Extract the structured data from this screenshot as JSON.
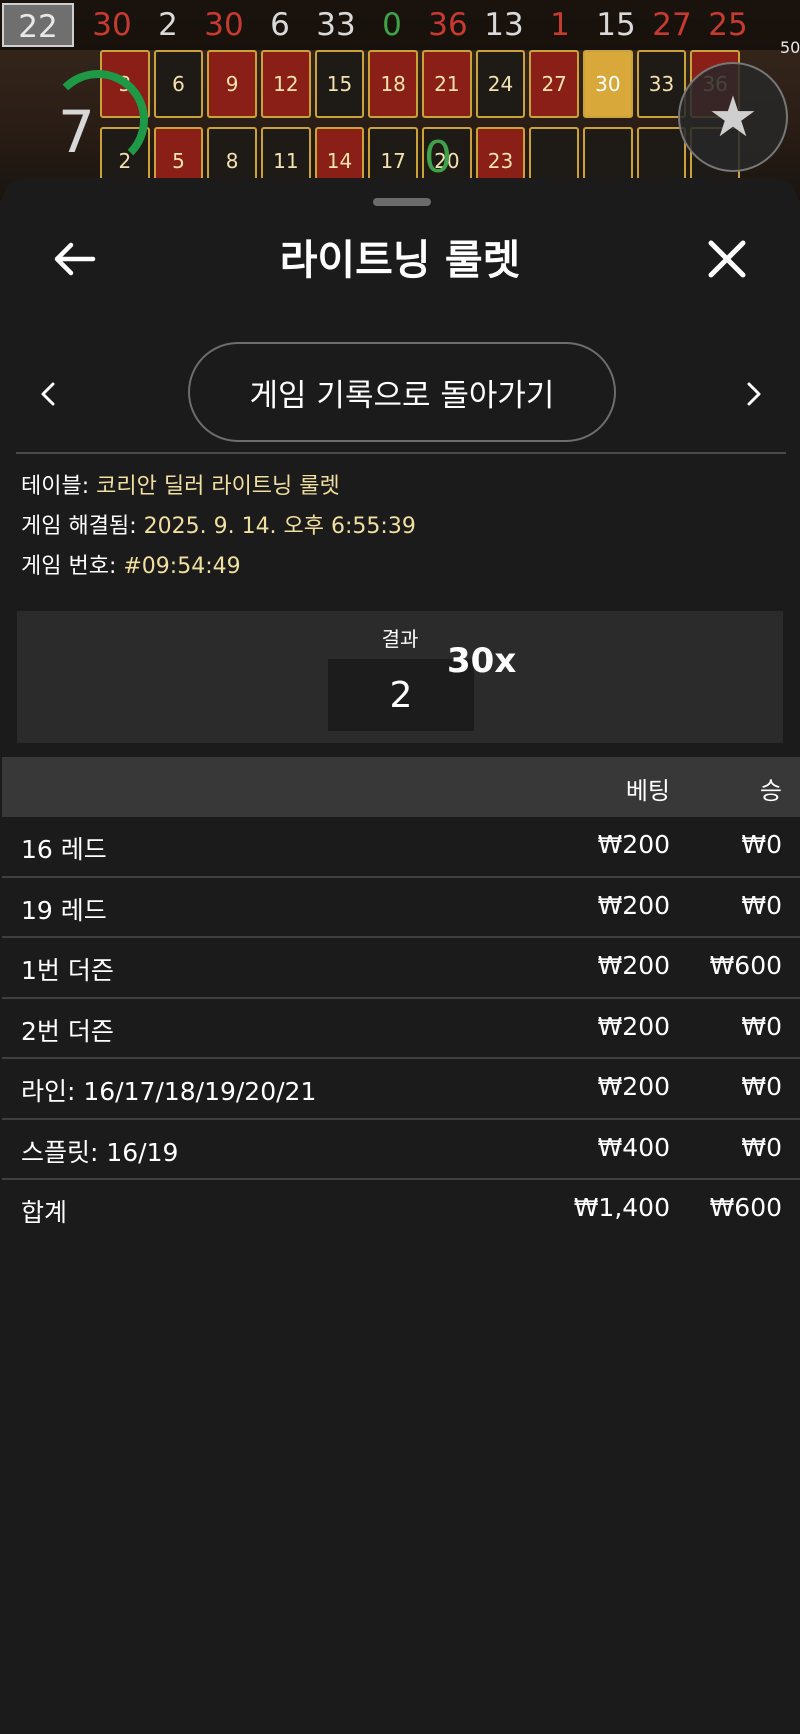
{
  "background": {
    "history": [
      {
        "n": "22",
        "color": "latest"
      },
      {
        "n": "30",
        "color": "red"
      },
      {
        "n": "2",
        "color": "black"
      },
      {
        "n": "30",
        "color": "red"
      },
      {
        "n": "6",
        "color": "black"
      },
      {
        "n": "33",
        "color": "black"
      },
      {
        "n": "0",
        "color": "green"
      },
      {
        "n": "36",
        "color": "red"
      },
      {
        "n": "13",
        "color": "black"
      },
      {
        "n": "1",
        "color": "red"
      },
      {
        "n": "15",
        "color": "black"
      },
      {
        "n": "27",
        "color": "red"
      },
      {
        "n": "25",
        "color": "red"
      }
    ],
    "board_row1": [
      "3",
      "6",
      "9",
      "12",
      "15",
      "18",
      "21",
      "24",
      "27",
      "30",
      "33",
      "36"
    ],
    "board_row2": [
      "2",
      "5",
      "8",
      "11",
      "14",
      "17",
      "20",
      "23",
      "",
      "",
      "",
      ""
    ],
    "timer": "7",
    "zero": "0",
    "corner_mini": "50"
  },
  "sheet": {
    "title": "라이트닝 룰렛",
    "back_to_history": "게임 기록으로 돌아가기",
    "info": {
      "table_label": "테이블: ",
      "table_value": "코리안 딜러 라이트닝 룰렛",
      "resolved_label": "게임 해결됨: ",
      "resolved_value": "2025. 9. 14. 오후 6:55:39",
      "number_label": "게임 번호: ",
      "number_value": "#09:54:49"
    },
    "result": {
      "label": "결과",
      "number": "2",
      "multiplier": "30x"
    },
    "table": {
      "col_bet": "베팅",
      "col_win": "승",
      "rows": [
        {
          "name": "16 레드",
          "bet": "₩200",
          "win": "₩0"
        },
        {
          "name": "19 레드",
          "bet": "₩200",
          "win": "₩0"
        },
        {
          "name": "1번 더즌",
          "bet": "₩200",
          "win": "₩600"
        },
        {
          "name": "2번 더즌",
          "bet": "₩200",
          "win": "₩0"
        },
        {
          "name": "라인: 16/17/18/19/20/21",
          "bet": "₩200",
          "win": "₩0"
        },
        {
          "name": "스플릿: 16/19",
          "bet": "₩400",
          "win": "₩0"
        }
      ],
      "total": {
        "name": "합계",
        "bet": "₩1,400",
        "win": "₩600"
      }
    }
  }
}
